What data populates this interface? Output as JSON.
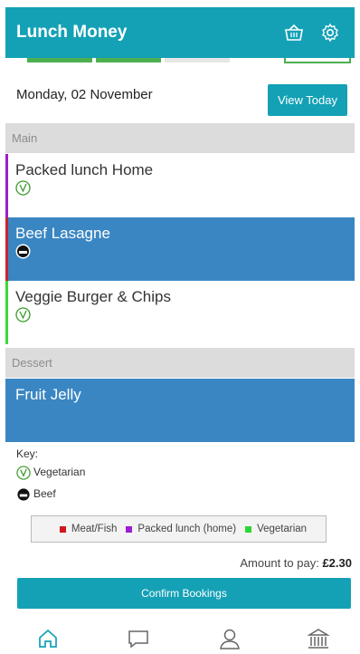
{
  "app": {
    "title": "Lunch Money"
  },
  "header": {
    "icons": [
      "basket-icon",
      "gear-icon"
    ]
  },
  "date_row": {
    "date": "Monday, 02 November",
    "view_today_label": "View Today"
  },
  "sections": {
    "main_label": "Main",
    "main_items": [
      {
        "name": "Packed lunch Home",
        "icon": "vegetarian-icon",
        "category_color": "#9b1fd0"
      },
      {
        "name": "Beef Lasagne",
        "icon": "beef-icon",
        "category_color": "#c8232c",
        "selected": true
      },
      {
        "name": "Veggie Burger & Chips",
        "icon": "vegetarian-icon",
        "category_color": "#3cd83a"
      }
    ],
    "dessert_label": "Dessert",
    "dessert_items": [
      {
        "name": "Fruit Jelly",
        "selected": true
      }
    ]
  },
  "key": {
    "title": "Key:",
    "vegetarian": "Vegetarian",
    "beef": "Beef"
  },
  "legend": [
    {
      "label": "Meat/Fish",
      "color": "#d0181f"
    },
    {
      "label": "Packed lunch (home)",
      "color": "#9b1fd0"
    },
    {
      "label": "Vegetarian",
      "color": "#29d832"
    }
  ],
  "payment": {
    "amount_label": "Amount to pay:",
    "amount_value": "£2.30",
    "confirm_label": "Confirm Bookings"
  },
  "colors": {
    "accent": "#14a1b6",
    "selected": "#3a86c3",
    "section_bg": "#dcdcdc"
  },
  "bottom_nav": [
    "home-icon",
    "chat-icon",
    "profile-icon",
    "bank-icon"
  ]
}
